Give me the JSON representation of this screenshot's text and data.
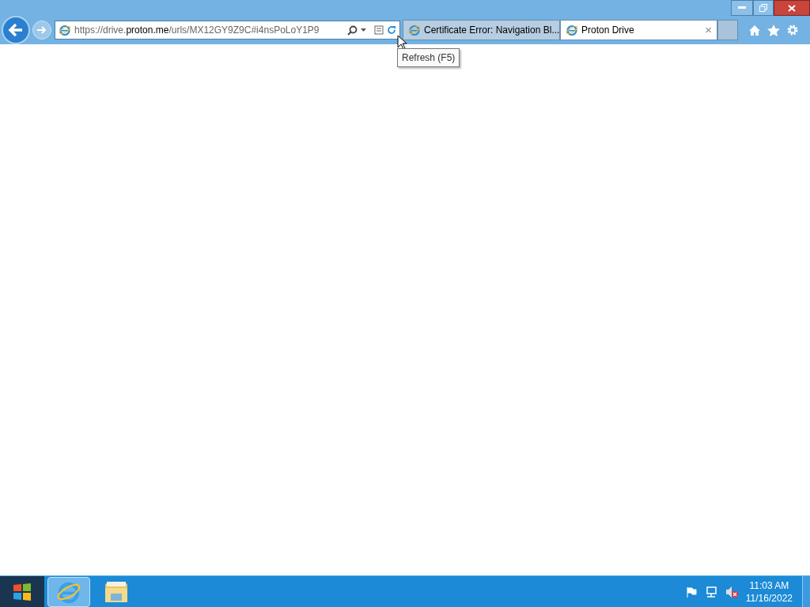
{
  "address_bar": {
    "url": "https://drive.**proton.me**/urls/MX12GY9Z9C#i4nsPoLoY1P9"
  },
  "tabs": [
    {
      "label": "Certificate Error: Navigation Bl...",
      "selected": false
    },
    {
      "label": "Proton Drive",
      "selected": true,
      "close": "×"
    }
  ],
  "tooltip": "Refresh (F5)",
  "taskbar": {
    "buttons": [
      {
        "kind": "browser",
        "selected": true
      },
      {
        "kind": "folder",
        "selected": false
      }
    ],
    "time": "11:03 AM",
    "date": "11/16/2022"
  }
}
